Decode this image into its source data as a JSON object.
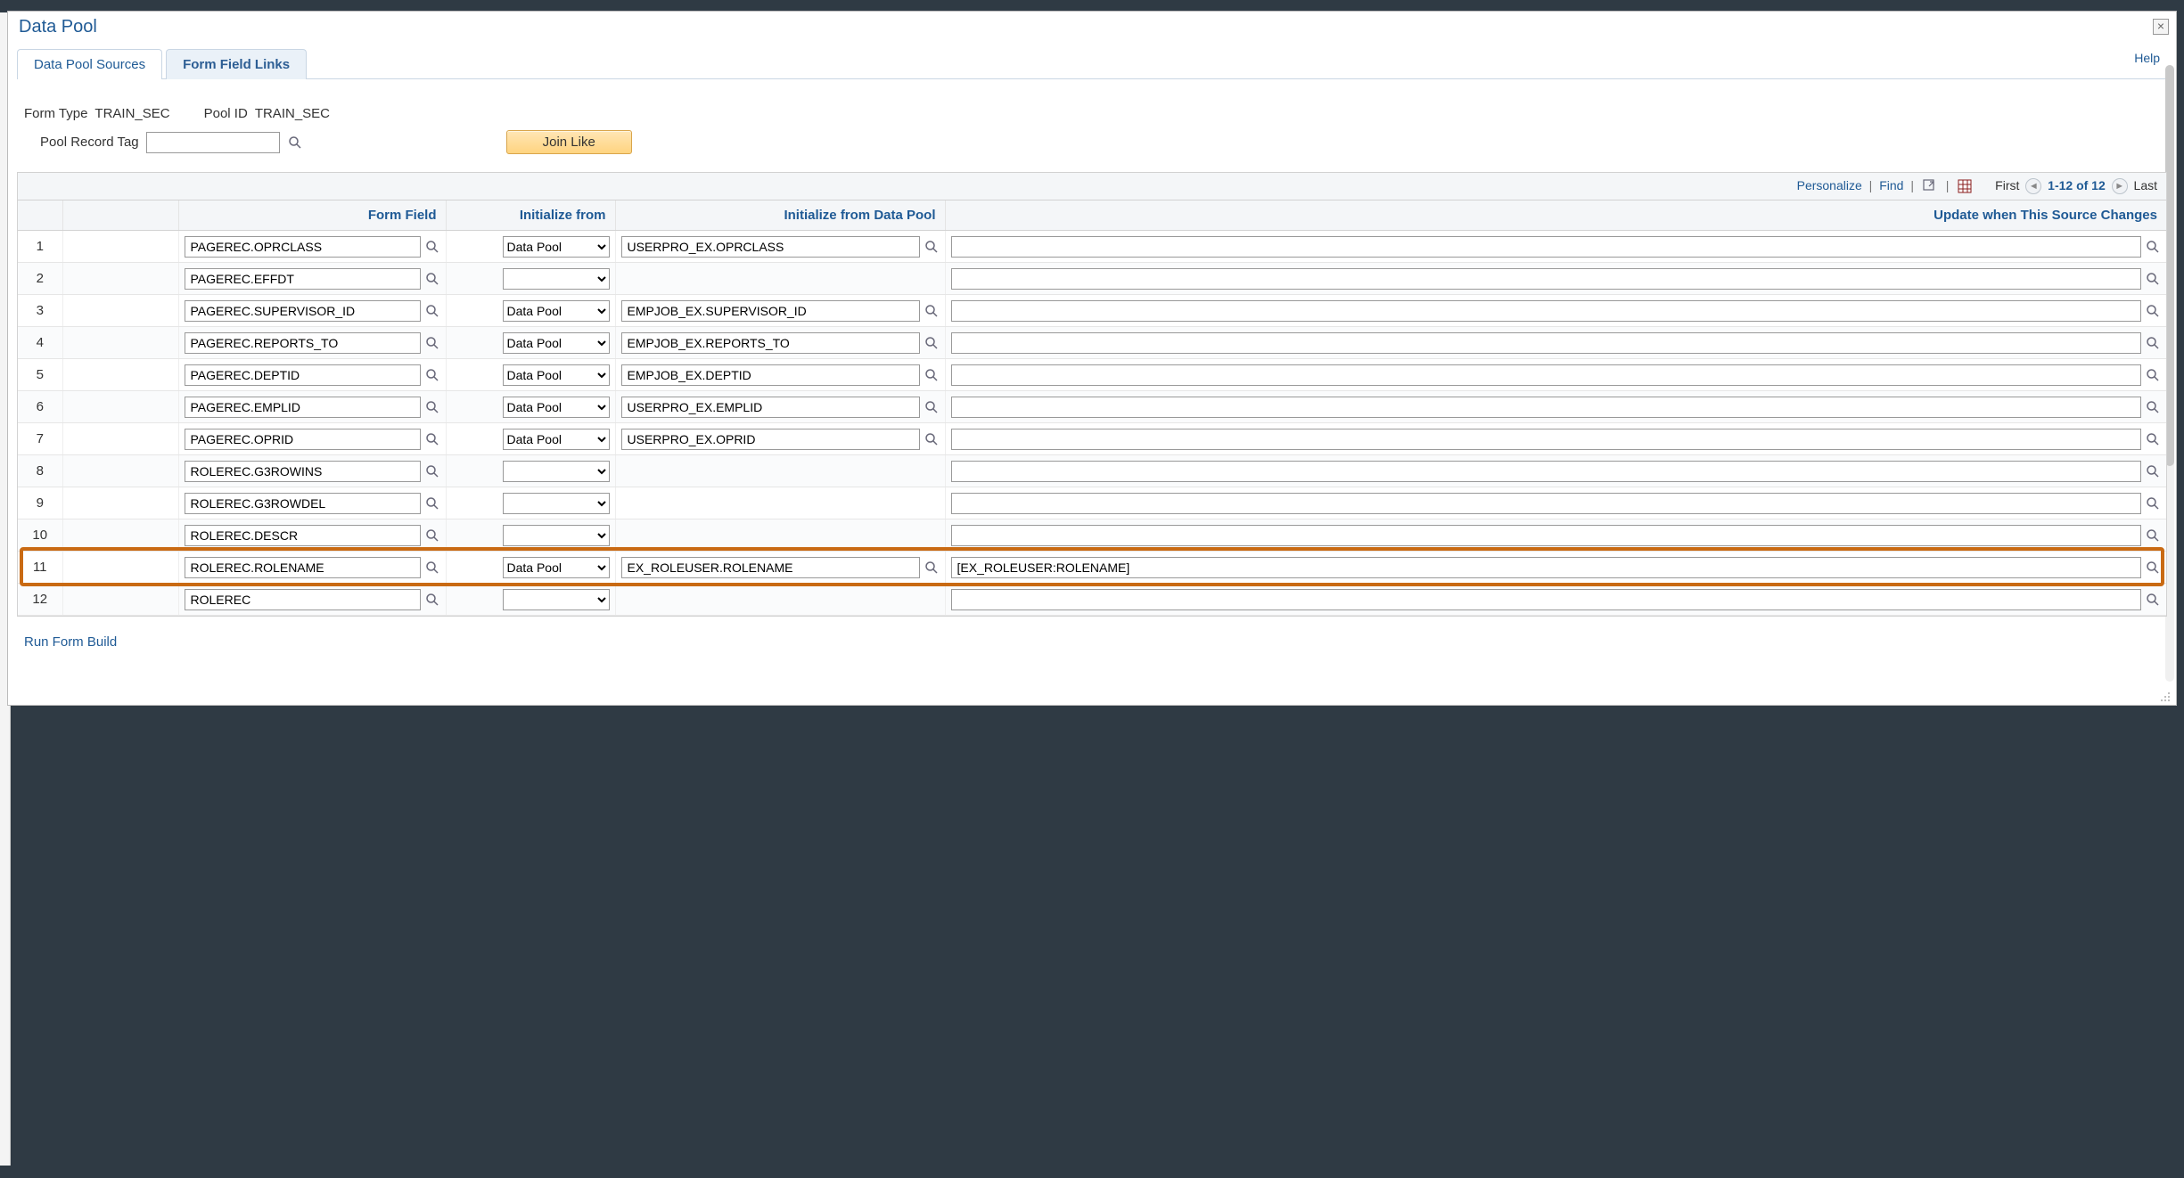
{
  "modal": {
    "title": "Data Pool",
    "close": "×",
    "help": "Help"
  },
  "tabs": {
    "sources": "Data Pool Sources",
    "links": "Form Field Links"
  },
  "form": {
    "form_type_label": "Form Type",
    "form_type_value": "TRAIN_SEC",
    "pool_id_label": "Pool ID",
    "pool_id_value": "TRAIN_SEC",
    "pool_record_tag_label": "Pool Record Tag",
    "pool_record_tag_value": "",
    "join_like_btn": "Join Like"
  },
  "grid": {
    "toolbar": {
      "personalize": "Personalize",
      "find": "Find",
      "first": "First",
      "range": "1-12 of 12",
      "last": "Last"
    },
    "headers": {
      "form_field": "Form Field",
      "initialize_from": "Initialize from",
      "initialize_from_data_pool": "Initialize from Data Pool",
      "update_when": "Update when This Source Changes"
    },
    "init_options": {
      "blank": "",
      "datapool": "Data Pool"
    },
    "rows": [
      {
        "n": "1",
        "form_field": "PAGEREC.OPRCLASS",
        "init_from": "Data Pool",
        "init_dp": "USERPRO_EX.OPRCLASS",
        "update": ""
      },
      {
        "n": "2",
        "form_field": "PAGEREC.EFFDT",
        "init_from": "",
        "init_dp": "",
        "update": ""
      },
      {
        "n": "3",
        "form_field": "PAGEREC.SUPERVISOR_ID",
        "init_from": "Data Pool",
        "init_dp": "EMPJOB_EX.SUPERVISOR_ID",
        "update": ""
      },
      {
        "n": "4",
        "form_field": "PAGEREC.REPORTS_TO",
        "init_from": "Data Pool",
        "init_dp": "EMPJOB_EX.REPORTS_TO",
        "update": ""
      },
      {
        "n": "5",
        "form_field": "PAGEREC.DEPTID",
        "init_from": "Data Pool",
        "init_dp": "EMPJOB_EX.DEPTID",
        "update": ""
      },
      {
        "n": "6",
        "form_field": "PAGEREC.EMPLID",
        "init_from": "Data Pool",
        "init_dp": "USERPRO_EX.EMPLID",
        "update": ""
      },
      {
        "n": "7",
        "form_field": "PAGEREC.OPRID",
        "init_from": "Data Pool",
        "init_dp": "USERPRO_EX.OPRID",
        "update": ""
      },
      {
        "n": "8",
        "form_field": "ROLEREC.G3ROWINS",
        "init_from": "",
        "init_dp": "",
        "update": ""
      },
      {
        "n": "9",
        "form_field": "ROLEREC.G3ROWDEL",
        "init_from": "",
        "init_dp": "",
        "update": ""
      },
      {
        "n": "10",
        "form_field": "ROLEREC.DESCR",
        "init_from": "",
        "init_dp": "",
        "update": ""
      },
      {
        "n": "11",
        "form_field": "ROLEREC.ROLENAME",
        "init_from": "Data Pool",
        "init_dp": "EX_ROLEUSER.ROLENAME",
        "update": "[EX_ROLEUSER:ROLENAME]"
      },
      {
        "n": "12",
        "form_field": "ROLEREC",
        "init_from": "",
        "init_dp": "",
        "update": ""
      }
    ]
  },
  "footer": {
    "run_form_build": "Run Form Build"
  }
}
